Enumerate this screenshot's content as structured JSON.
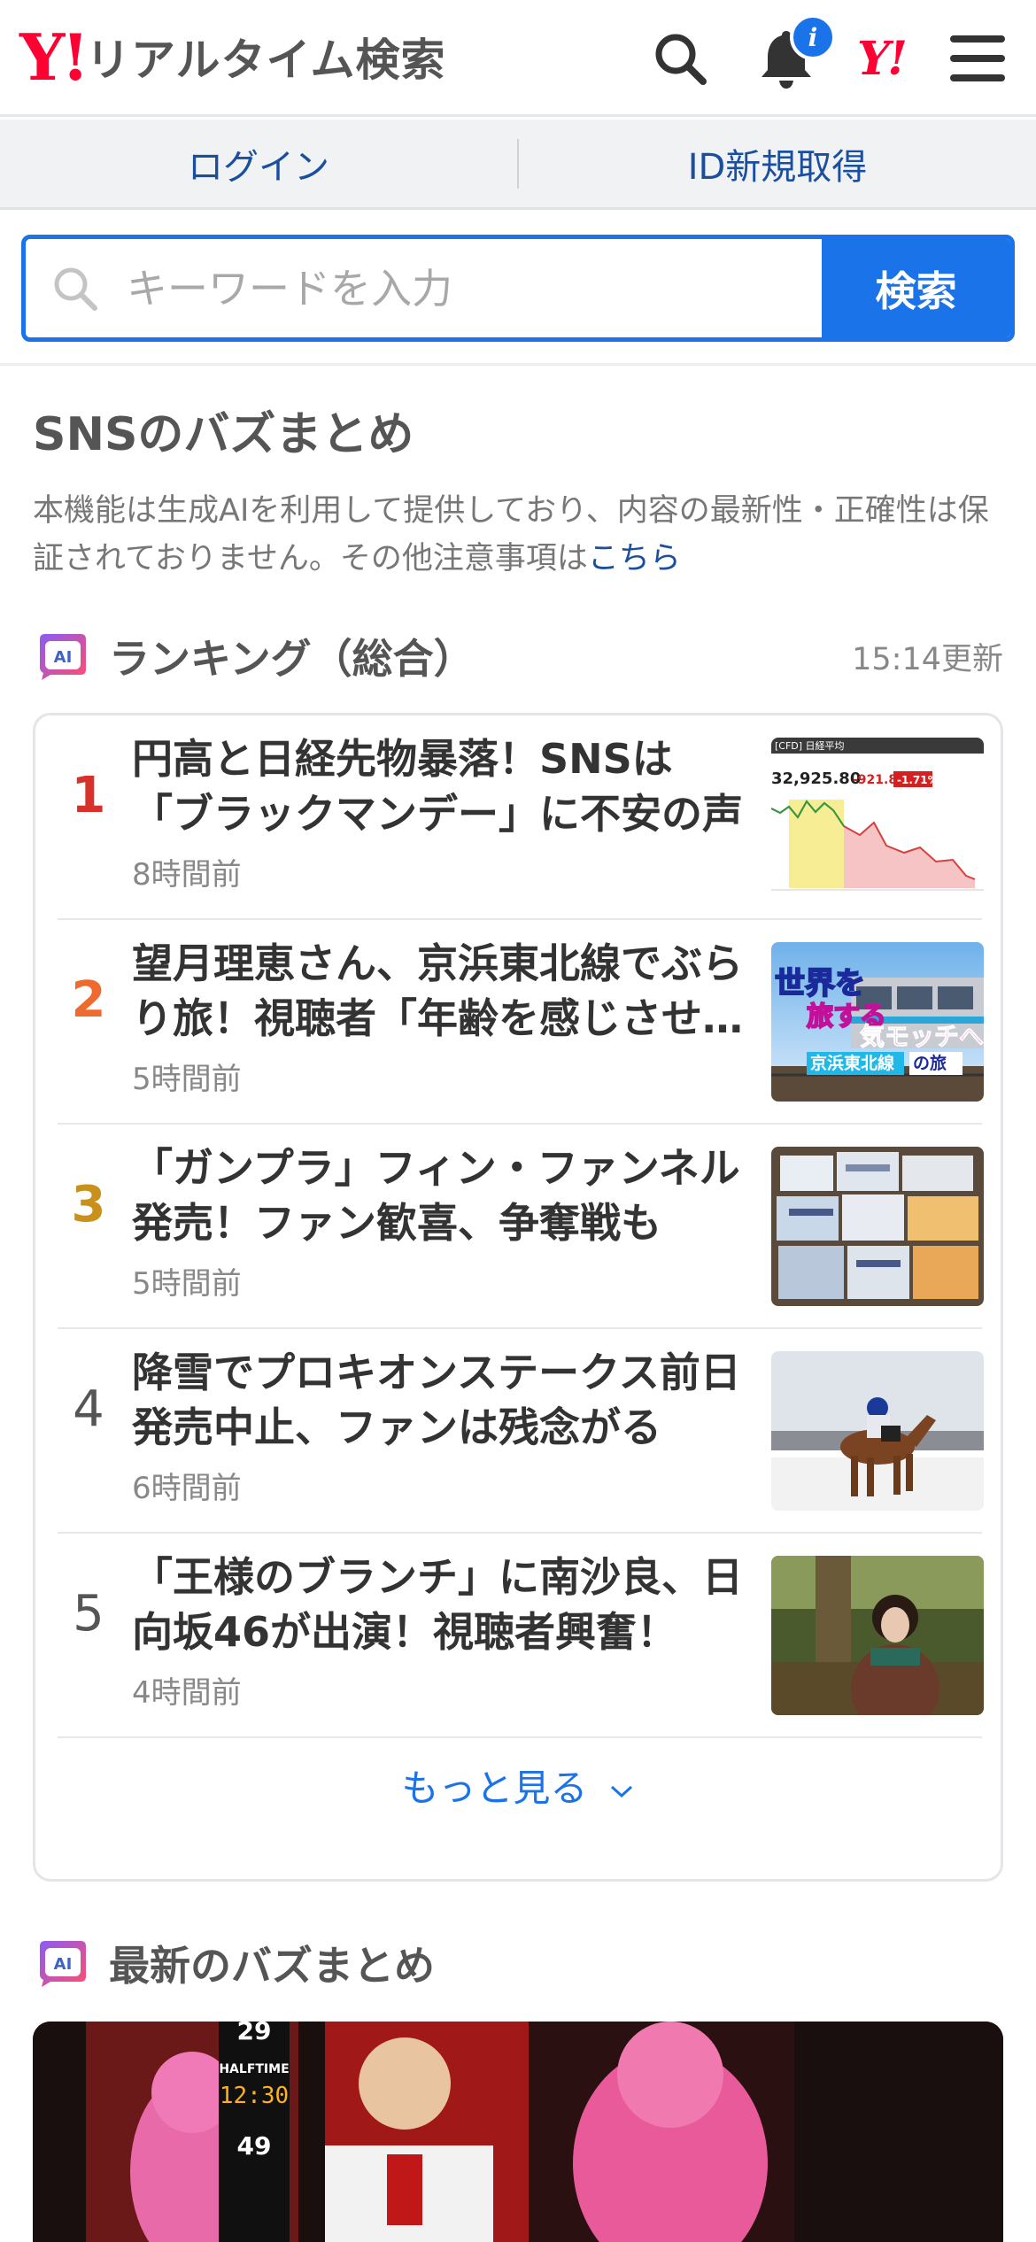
{
  "header": {
    "logo_mark": "Y!",
    "logo_text": "リアルタイム検索",
    "notification_count": "i",
    "brand_mark": "Y!"
  },
  "login_bar": {
    "login": "ログイン",
    "register": "ID新規取得"
  },
  "search": {
    "placeholder": "キーワードを入力",
    "button": "検索"
  },
  "sns_section": {
    "title": "SNSのバズまとめ",
    "notice": "本機能は生成AIを利用して提供しており、内容の最新性・正確性は保証されておりません。その他注意事項は",
    "notice_link": "こちら"
  },
  "ranking": {
    "badge": "AI",
    "title": "ランキング（総合）",
    "updated": "15:14更新",
    "items": [
      {
        "rank": "1",
        "headline": "円高と日経先物暴落！SNSは「ブラックマンデー」に不安の声",
        "ago": "8時間前",
        "thumb": {
          "header": "[CFD] 日経平均",
          "price": "32,925.80",
          "change": "-921.87",
          "pct": "-1.71%"
        }
      },
      {
        "rank": "2",
        "headline": "望月理恵さん、京浜東北線でぶらり旅！視聴者「年齢を感じさせ…",
        "ago": "5時間前",
        "thumb": {
          "line1": "世界を",
          "line2": "旅する",
          "line3": "気モッチへ",
          "line4": "京浜東北線",
          "line5": "の旅"
        }
      },
      {
        "rank": "3",
        "headline": "「ガンプラ」フィン・ファンネル発売！ファン歓喜、争奪戦も",
        "ago": "5時間前"
      },
      {
        "rank": "4",
        "headline": "降雪でプロキオンステークス前日発売中止、ファンは残念がる",
        "ago": "6時間前"
      },
      {
        "rank": "5",
        "headline": "「王様のブランチ」に南沙良、日向坂46が出演！視聴者興奮！",
        "ago": "4時間前"
      }
    ],
    "more": "もっと見る"
  },
  "latest": {
    "badge": "AI",
    "title": "最新のバズまとめ",
    "hero": {
      "score_top": "29",
      "halftime": "HALFTIME",
      "clock": "12:30",
      "score_bottom": "49"
    }
  },
  "colors": {
    "accent": "#1a73e8",
    "brand_red": "#ff0033",
    "rank1": "#d6322b",
    "rank2": "#ee6b2f",
    "rank3": "#c9901c",
    "link": "#1a4fa0"
  },
  "icons": [
    "search-icon",
    "bell-icon",
    "hamburger-menu-icon",
    "chevron-down-icon",
    "ai-badge-icon"
  ]
}
